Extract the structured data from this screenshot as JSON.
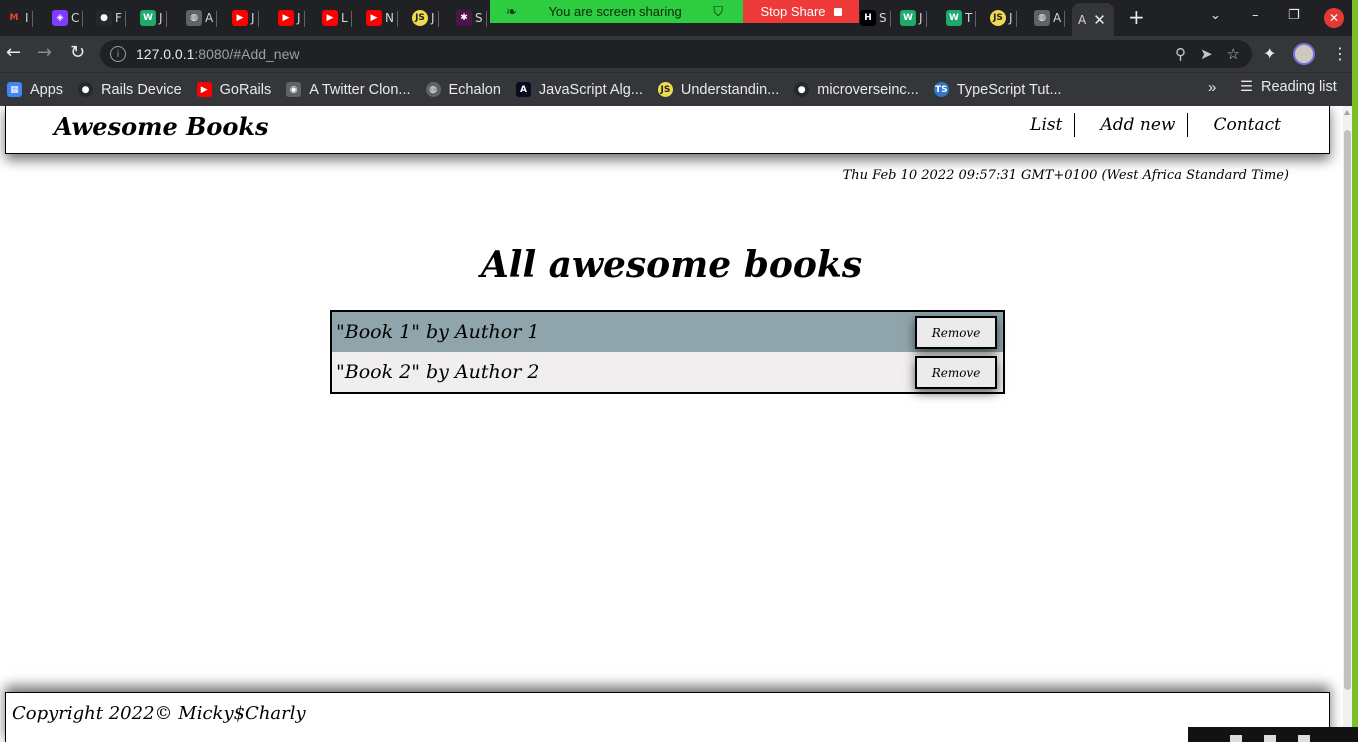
{
  "browser": {
    "tabs": [
      {
        "icon": "gmail-icon",
        "text": "I",
        "color": "#ea4335",
        "glyph": "M"
      },
      {
        "icon": "app-icon",
        "text": "C",
        "color": "#7d3cff",
        "glyph": "◈"
      },
      {
        "icon": "github-icon",
        "text": "F",
        "color": "#24292e",
        "glyph": "●"
      },
      {
        "icon": "webflow-icon",
        "text": "J",
        "color": "#1eaa6b",
        "glyph": "W"
      },
      {
        "icon": "globe-icon",
        "text": "A",
        "color": "#5f6368",
        "glyph": "◍"
      },
      {
        "icon": "youtube-icon",
        "text": "J",
        "color": "#ff0000",
        "glyph": "▶"
      },
      {
        "icon": "youtube-icon",
        "text": "J",
        "color": "#ff0000",
        "glyph": "▶"
      },
      {
        "icon": "youtube-icon",
        "text": "L",
        "color": "#ff0000",
        "glyph": "▶"
      },
      {
        "icon": "youtube-icon",
        "text": "N",
        "color": "#ff0000",
        "glyph": "▶"
      },
      {
        "icon": "js-icon",
        "text": "J",
        "color": "#f0db4f",
        "glyph": "JS"
      },
      {
        "icon": "slack-icon",
        "text": "S",
        "color": "#4a154b",
        "glyph": "✱"
      },
      {
        "icon": "dev-icon",
        "text": "S",
        "color": "#000000",
        "glyph": "H"
      },
      {
        "icon": "webflow-icon",
        "text": "J",
        "color": "#1eaa6b",
        "glyph": "W"
      },
      {
        "icon": "webflow-icon",
        "text": "T",
        "color": "#1eaa6b",
        "glyph": "W"
      },
      {
        "icon": "js-icon",
        "text": "J",
        "color": "#f0db4f",
        "glyph": "JS"
      },
      {
        "icon": "globe-icon",
        "text": "A",
        "color": "#5f6368",
        "glyph": "◍"
      }
    ],
    "active_tab": {
      "text": "A"
    },
    "share": {
      "message": "You are screen sharing",
      "stop": "Stop Share"
    },
    "url": {
      "host": "127.0.0.1",
      "path": ":8080/#Add_new"
    },
    "bookmarks": [
      {
        "label": "Apps",
        "icon": "apps-grid-icon",
        "color": "#4285f4",
        "glyph": "▦"
      },
      {
        "label": "Rails Device",
        "icon": "github-icon",
        "color": "#24292e",
        "glyph": "●"
      },
      {
        "label": "GoRails",
        "icon": "youtube-icon",
        "color": "#ff0000",
        "glyph": "▶"
      },
      {
        "label": "A Twitter Clon...",
        "icon": "twitter-clone-icon",
        "color": "#5f6368",
        "glyph": "◉"
      },
      {
        "label": "Echalon",
        "icon": "globe-icon",
        "color": "#5f6368",
        "glyph": "◍"
      },
      {
        "label": "JavaScript Alg...",
        "icon": "algo-icon",
        "color": "#0b0b20",
        "glyph": "A"
      },
      {
        "label": "Understandin...",
        "icon": "js-icon",
        "color": "#f0db4f",
        "glyph": "JS"
      },
      {
        "label": "microverseinc...",
        "icon": "github-icon",
        "color": "#24292e",
        "glyph": "●"
      },
      {
        "label": "TypeScript Tut...",
        "icon": "typescript-icon",
        "color": "#3178c6",
        "glyph": "TS"
      }
    ],
    "reading_list": "Reading list"
  },
  "app": {
    "brand": "Awesome Books",
    "nav": [
      "List",
      "Add new",
      "Contact"
    ],
    "datetime": "Thu Feb 10 2022 09:57:31 GMT+0100 (West Africa Standard Time)",
    "title": "All awesome books",
    "books": [
      {
        "text": "\"Book 1\" by Author 1",
        "button": "Remove"
      },
      {
        "text": "\"Book 2\" by Author 2",
        "button": "Remove"
      }
    ],
    "footer": "Copyright 2022© Micky$Charly"
  }
}
